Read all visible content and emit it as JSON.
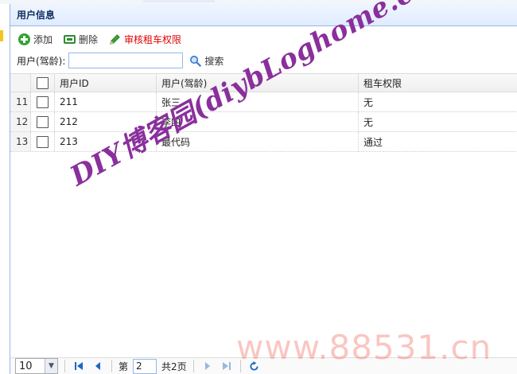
{
  "panel": {
    "title": "用户信息"
  },
  "toolbar": {
    "add_label": "添加",
    "delete_label": "删除",
    "review_label": "审核租车权限"
  },
  "search": {
    "label": "用户(驾龄):",
    "value": "",
    "placeholder": "",
    "button_label": "搜索"
  },
  "table": {
    "columns": [
      "用户ID",
      "用户(驾龄)",
      "租车权限"
    ],
    "rows": [
      {
        "num": "11",
        "id": "211",
        "name": "张三",
        "perm": "无"
      },
      {
        "num": "12",
        "id": "212",
        "name": "李四",
        "perm": "无"
      },
      {
        "num": "13",
        "id": "213",
        "name": "最代码",
        "perm": "通过"
      }
    ]
  },
  "pager": {
    "page_size": "10",
    "page_prefix": "第",
    "current_page": "2",
    "total_pages": "共2页"
  },
  "watermarks": {
    "purple": "DIY博客园(diybLoghome.com)",
    "red": "www.88531.cn"
  },
  "colors": {
    "header_border": "#95b8e7",
    "review_text": "#e00000",
    "watermark_purple": "#8a2f9c"
  },
  "icons": [
    "add-icon",
    "delete-icon",
    "pencil-icon",
    "search-icon",
    "first-page-icon",
    "prev-page-icon",
    "next-page-icon",
    "last-page-icon",
    "refresh-icon"
  ]
}
